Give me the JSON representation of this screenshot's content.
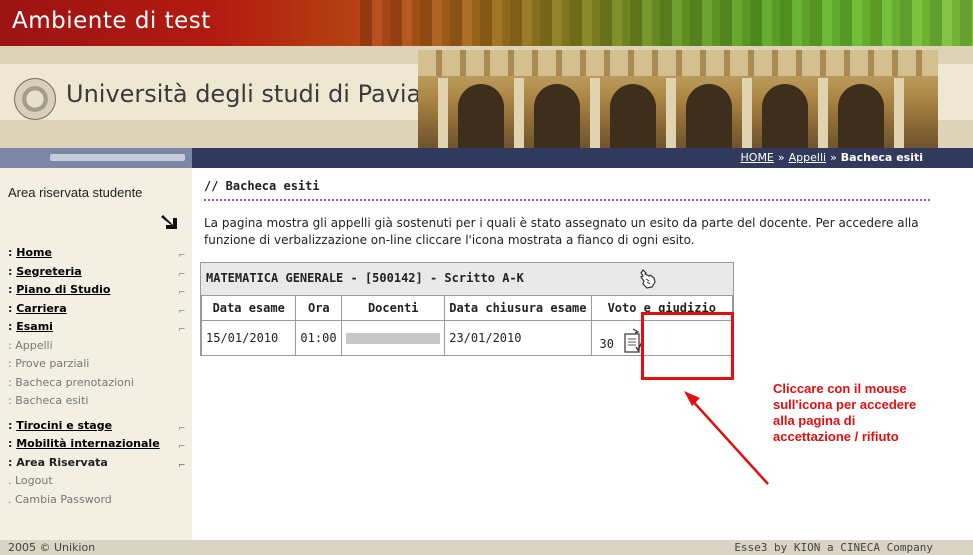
{
  "header": {
    "env_title": "Ambiente di test",
    "university_name": "Università degli studi di Pavia"
  },
  "breadcrumb": {
    "home": "HOME",
    "sep1": "»",
    "appelli": "Appelli",
    "sep2": "»",
    "current": "Bacheca esiti"
  },
  "sidebar": {
    "area_title": "Area riservata studente",
    "items": [
      {
        "label": "Home",
        "prefix": ": "
      },
      {
        "label": "Segreteria",
        "prefix": ": "
      },
      {
        "label": "Piano di Studio",
        "prefix": ": "
      },
      {
        "label": "Carriera",
        "prefix": ": "
      },
      {
        "label": "Esami",
        "prefix": ": "
      },
      {
        "label": "Appelli",
        "prefix": ": "
      },
      {
        "label": "Prove parziali",
        "prefix": ": "
      },
      {
        "label": "Bacheca prenotazioni",
        "prefix": ": "
      },
      {
        "label": "Bacheca esiti",
        "prefix": ": "
      },
      {
        "label": "Tirocini e stage",
        "prefix": ": "
      },
      {
        "label": "Mobilità internazionale",
        "prefix": ": "
      },
      {
        "label": "Area Riservata",
        "prefix": ": "
      },
      {
        "label": "Logout",
        "prefix": ". "
      },
      {
        "label": "Cambia Password",
        "prefix": ". "
      }
    ],
    "expand_glyph": "⌐"
  },
  "main": {
    "page_title": "// Bacheca esiti",
    "description": "La pagina mostra gli appelli già sostenuti per i quali è stato assegnato un esito da parte del docente. Per accedere alla funzione di verbalizzazione on-line cliccare l'icona mostrata a fianco di ogni esito.",
    "course_title": "MATEMATICA GENERALE - [500142] - Scritto A-K",
    "table": {
      "headers": [
        "Data esame",
        "Ora",
        "Docenti",
        "Data chiusura esame",
        "Voto e giudizio"
      ],
      "rows": [
        {
          "data_esame": "15/01/2010",
          "ora": "01:00",
          "data_chiusura": "23/01/2010",
          "voto": "30"
        }
      ]
    },
    "annotation": "Cliccare con il mouse sull'icona per accedere alla pagina di accettazione / rifiuto"
  },
  "footer": {
    "left": "2005 © Unikion",
    "right": "Esse3 by KION a CINECA Company"
  },
  "colors": {
    "navbar": "#313a5c",
    "annotation_red": "#e01010",
    "sidebar_bg": "#f3efe3"
  }
}
